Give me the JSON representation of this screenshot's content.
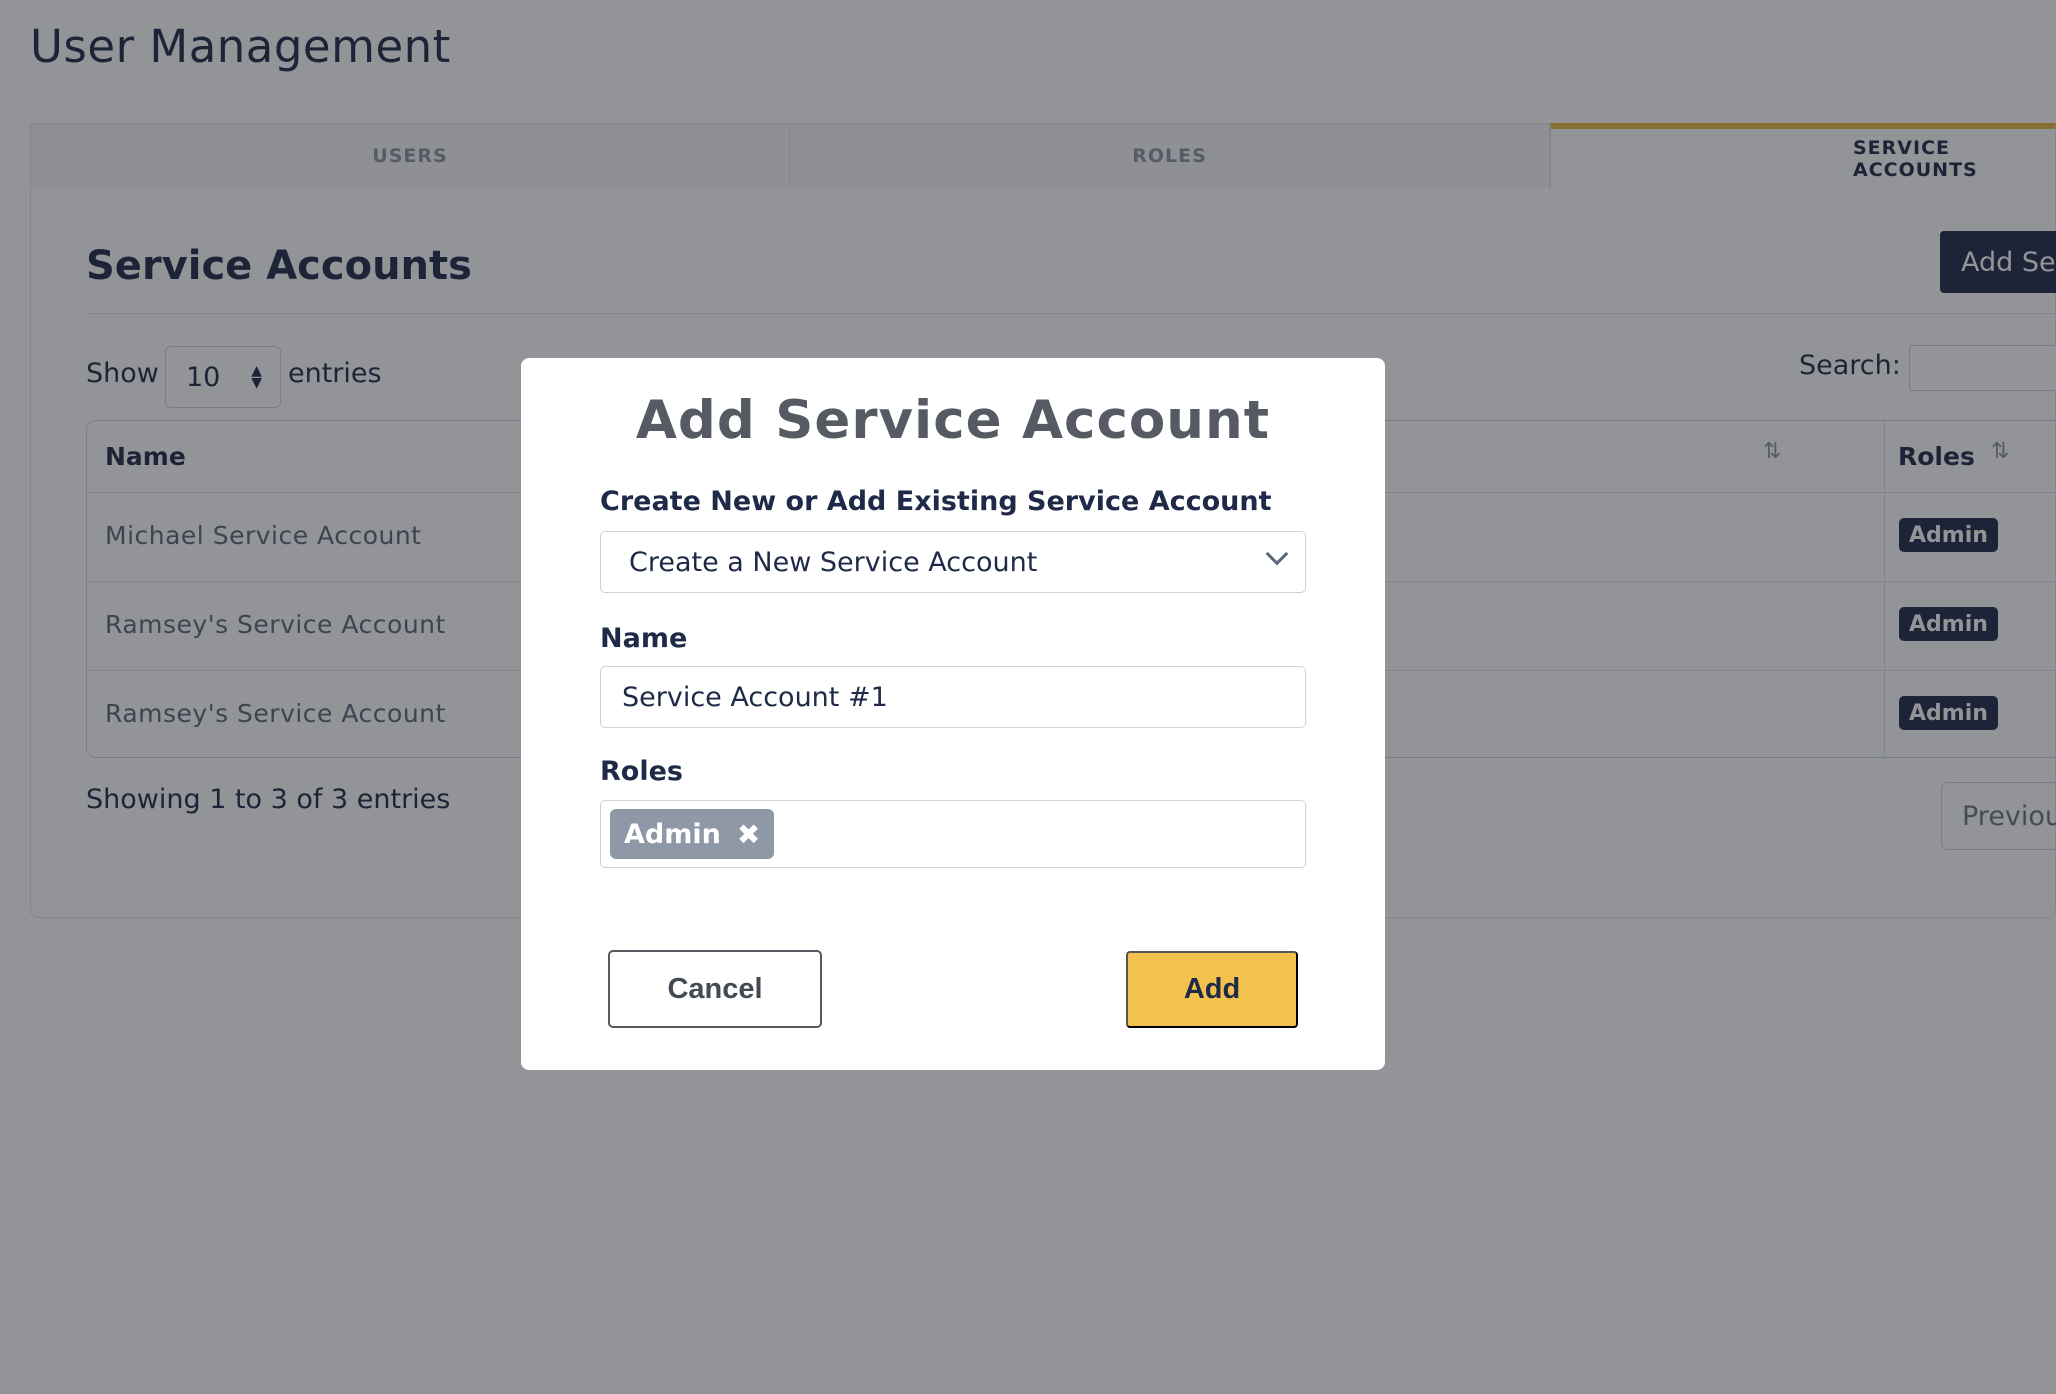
{
  "page": {
    "title": "User Management"
  },
  "tabs": [
    {
      "label": "USERS",
      "active": false
    },
    {
      "label": "ROLES",
      "active": false
    },
    {
      "label": "SERVICE ACCOUNTS",
      "active": true
    }
  ],
  "section": {
    "title": "Service Accounts",
    "add_button_label": "Add Se"
  },
  "table_controls": {
    "show_label": "Show",
    "entries_value": "10",
    "entries_label": "entries",
    "search_label": "Search:"
  },
  "table": {
    "columns": [
      {
        "label": "Name"
      },
      {
        "label": "Roles"
      }
    ],
    "rows": [
      {
        "name": "Michael Service Account",
        "role": "Admin"
      },
      {
        "name": "Ramsey's Service Account",
        "role": "Admin"
      },
      {
        "name": "Ramsey's Service Account",
        "role": "Admin"
      }
    ]
  },
  "pagination": {
    "summary": "Showing 1 to 3 of 3 entries",
    "previous_label": "Previou"
  },
  "modal": {
    "title": "Add Service Account",
    "mode_label": "Create New or Add Existing Service Account",
    "mode_value": "Create a New Service Account",
    "name_label": "Name",
    "name_value": "Service Account #1",
    "roles_label": "Roles",
    "selected_role": "Admin",
    "cancel_label": "Cancel",
    "add_label": "Add"
  },
  "icons": {
    "sort": "sort-arrows-icon",
    "chevron": "chevron-down-icon",
    "remove": "close-icon"
  },
  "colors": {
    "navy": "#1e2a47",
    "accent_yellow": "#f2c14e",
    "tab_indicator": "#e6b83f"
  }
}
